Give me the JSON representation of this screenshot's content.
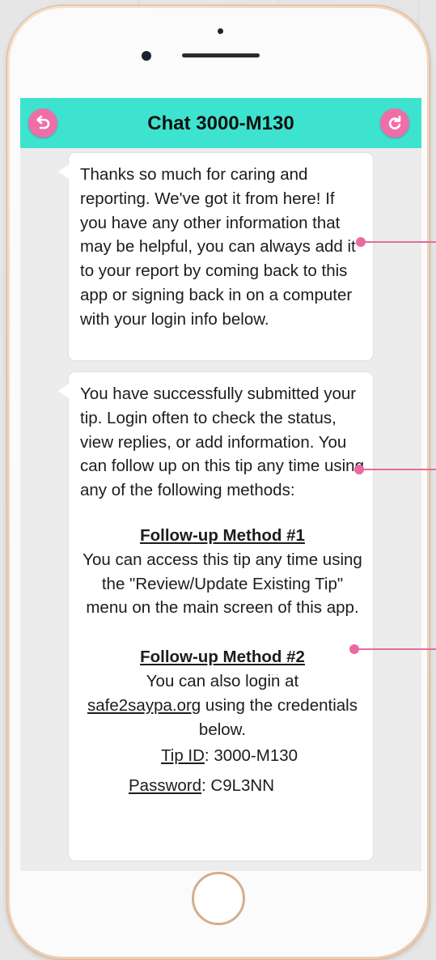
{
  "header": {
    "title": "Chat 3000-M130",
    "back_icon": "back-undo-icon",
    "refresh_icon": "refresh-icon"
  },
  "messages": [
    {
      "text": "Thanks so much for caring and reporting. We've got it from here! If you have any other information that may be helpful, you can always add it to your report by coming back to this app or signing back in on a computer with your login info below."
    },
    {
      "intro": "You have successfully submitted your tip. Login often to check the status, view replies, or add information. You can follow up on this tip any time using any of the following methods:",
      "method1": {
        "title": "Follow-up Method #1",
        "body": "You can access this tip any time using the \"Review/Update Existing Tip\" menu on the main screen of this app."
      },
      "method2": {
        "title": "Follow-up Method #2",
        "body_prefix": "You can also login at",
        "link": "safe2saypa.org",
        "body_suffix": "using the credentials below.",
        "tip_id_label": "Tip ID",
        "tip_id_value": "3000-M130",
        "password_label": "Password",
        "password_value": "C9L3NN"
      }
    }
  ],
  "colors": {
    "header_bg": "#3ee3cf",
    "button_pink": "#ef6ea7",
    "phone_frame": "#f1d2b7"
  }
}
